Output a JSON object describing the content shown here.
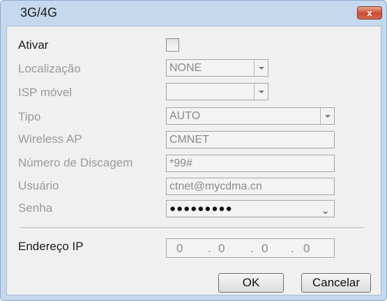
{
  "window": {
    "title": "3G/4G",
    "close_label": "x"
  },
  "form": {
    "enable_label": "Ativar",
    "enable_checked": false,
    "location_label": "Localização",
    "location_value": "NONE",
    "isp_label": "ISP móvel",
    "isp_value": "",
    "type_label": "Tipo",
    "type_value": "AUTO",
    "ap_label": "Wireless AP",
    "ap_value": "CMNET",
    "dial_label": "Número de Discagem",
    "dial_value": "*99#",
    "user_label": "Usuário",
    "user_value": "ctnet@mycdma.cn",
    "password_label": "Senha",
    "password_value": "●●●●●●●●●",
    "ip_label": "Endereço IP",
    "ip_octets": [
      "0",
      "0",
      "0",
      "0"
    ],
    "ip_separator": "."
  },
  "buttons": {
    "ok": "OK",
    "cancel": "Cancelar"
  },
  "icons": {
    "close": "close-icon",
    "dropdown": "chevron-down-icon"
  }
}
